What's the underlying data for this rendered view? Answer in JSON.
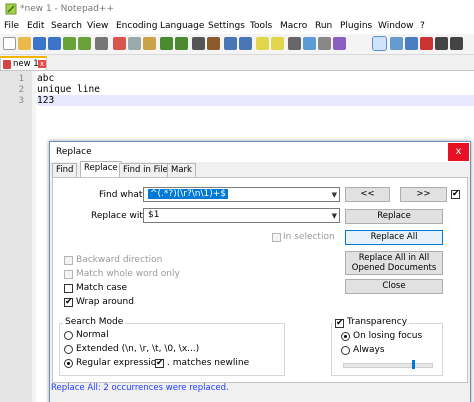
{
  "window": {
    "title": "*new 1 - Notepad++"
  },
  "menu": [
    "File",
    "Edit",
    "Search",
    "View",
    "Encoding",
    "Language",
    "Settings",
    "Tools",
    "Macro",
    "Run",
    "Plugins",
    "Window",
    "?"
  ],
  "tab": {
    "label": "new 1",
    "close": "x"
  },
  "editor": {
    "lines": [
      {
        "num": "1",
        "text": "abc"
      },
      {
        "num": "2",
        "text": "unique line"
      },
      {
        "num": "3",
        "text": "123"
      }
    ]
  },
  "dialog": {
    "title": "Replace",
    "close": "x",
    "tabs": [
      "Find",
      "Replace",
      "Find in Files",
      "Mark"
    ],
    "find_label": "Find what :",
    "find_value": "^(.*?)(\\r?\\n\\1)+$",
    "replace_label": "Replace with :",
    "replace_value": "$1",
    "in_selection": "In selection",
    "backward": "Backward direction",
    "whole_word": "Match whole word only",
    "match_case": "Match case",
    "wrap_around": "Wrap around",
    "search_mode_title": "Search Mode",
    "mode_normal": "Normal",
    "mode_extended": "Extended (\\n, \\r, \\t, \\0, \\x...)",
    "mode_regex": "Regular expression",
    "matches_newline": ". matches newline",
    "transparency": "Transparency",
    "on_losing_focus": "On losing focus",
    "always": "Always",
    "transparency_level": 0.78,
    "buttons": {
      "prev": "<<",
      "next": ">>",
      "replace": "Replace",
      "replace_all": "Replace All",
      "replace_all_docs": "Replace All in All Opened Documents",
      "close": "Close"
    },
    "status": "Replace All: 2 occurrences were replaced."
  },
  "colors": {
    "accent": "#0078d7",
    "status_text": "#1e3cff",
    "close_button": "#e81123",
    "tab_marker": "#f4b400"
  }
}
